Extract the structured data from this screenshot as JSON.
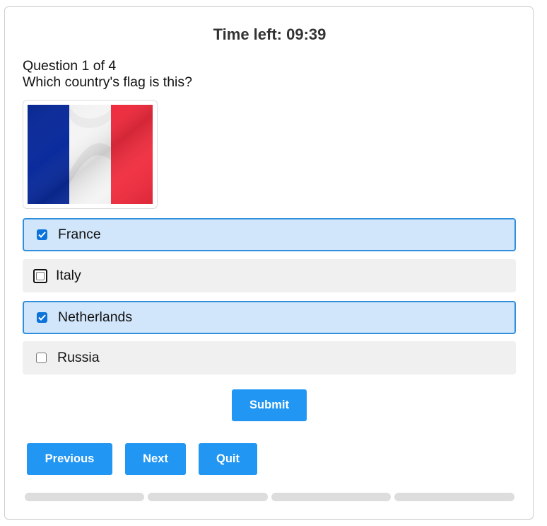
{
  "timer": {
    "text": "Time left: 09:39"
  },
  "question": {
    "number_text": "Question 1 of 4",
    "text": "Which country's flag is this?",
    "image_icon": "france-flag-image"
  },
  "options": [
    {
      "label": "France",
      "checked": true
    },
    {
      "label": "Italy",
      "checked": false
    },
    {
      "label": "Netherlands",
      "checked": true
    },
    {
      "label": "Russia",
      "checked": false
    }
  ],
  "buttons": {
    "submit": "Submit",
    "previous": "Previous",
    "next": "Next",
    "quit": "Quit"
  },
  "progress": {
    "total": 4,
    "completed": 0
  },
  "colors": {
    "accent": "#2196f3",
    "selected_bg": "#d2e6fb",
    "selected_border": "#2f8fdd",
    "option_bg": "#f0f0f0",
    "progress_track": "#dddddd",
    "flag_blue": "#0a2b9c",
    "flag_white": "#f4f4f4",
    "flag_red": "#ef2b3d"
  }
}
